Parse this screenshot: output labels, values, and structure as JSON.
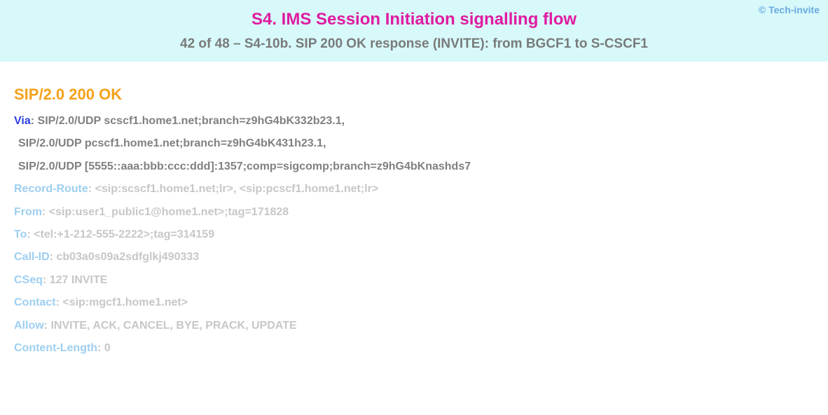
{
  "header": {
    "copyright": "© Tech-invite",
    "title": "S4. IMS Session Initiation signalling flow",
    "subtitle": "42 of 48 – S4-10b. SIP 200 OK response (INVITE): from BGCF1 to S-CSCF1"
  },
  "message": {
    "status_line": "SIP/2.0 200 OK",
    "via": {
      "label": "Via",
      "lines": [
        "SIP/2.0/UDP scscf1.home1.net;branch=z9hG4bK332b23.1,",
        "SIP/2.0/UDP pcscf1.home1.net;branch=z9hG4bK431h23.1,",
        "SIP/2.0/UDP [5555::aaa:bbb:ccc:ddd]:1357;comp=sigcomp;branch=z9hG4bKnashds7"
      ]
    },
    "record_route": {
      "label": "Record-Route",
      "value": "<sip:scscf1.home1.net;lr>, <sip:pcscf1.home1.net;lr>"
    },
    "from": {
      "label": "From",
      "value": "<sip:user1_public1@home1.net>;tag=171828"
    },
    "to": {
      "label": "To",
      "value": "<tel:+1-212-555-2222>;tag=314159"
    },
    "call_id": {
      "label": "Call-ID",
      "value": "cb03a0s09a2sdfglkj490333"
    },
    "cseq": {
      "label": "CSeq",
      "value": "127 INVITE"
    },
    "contact": {
      "label": "Contact",
      "value": "<sip:mgcf1.home1.net>"
    },
    "allow": {
      "label": "Allow",
      "value": "INVITE, ACK, CANCEL, BYE, PRACK, UPDATE"
    },
    "content_length": {
      "label": "Content-Length",
      "value": "0"
    }
  }
}
